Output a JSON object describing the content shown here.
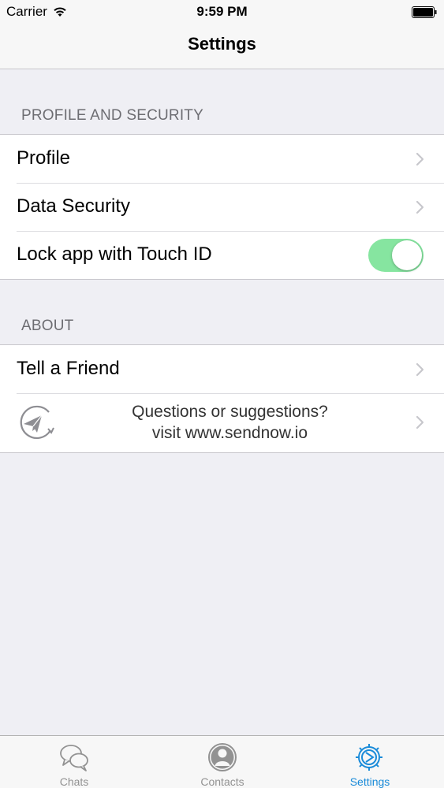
{
  "status_bar": {
    "carrier": "Carrier",
    "time": "9:59 PM"
  },
  "nav": {
    "title": "Settings"
  },
  "sections": {
    "profile_security": {
      "header": "PROFILE AND SECURITY",
      "items": [
        {
          "label": "Profile"
        },
        {
          "label": "Data Security"
        },
        {
          "label": "Lock app with Touch ID",
          "toggle_on": true
        }
      ]
    },
    "about": {
      "header": "ABOUT",
      "items": [
        {
          "label": "Tell a Friend"
        }
      ],
      "promo": {
        "line1": "Questions or suggestions?",
        "line2": "visit www.sendnow.io"
      }
    }
  },
  "tab_bar": {
    "tabs": [
      {
        "label": "Chats",
        "icon": "chat-bubbles-icon"
      },
      {
        "label": "Contacts",
        "icon": "contact-icon"
      },
      {
        "label": "Settings",
        "icon": "gear-icon",
        "active": true
      }
    ]
  },
  "colors": {
    "accent": "#1a8bd9",
    "toggle_on": "#86e5a0",
    "background": "#efeff4"
  }
}
